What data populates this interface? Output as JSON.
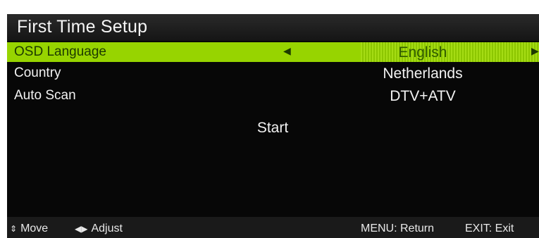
{
  "title": "First Time Setup",
  "menu": [
    {
      "label": "OSD Language",
      "value": "English",
      "selected": true
    },
    {
      "label": "Country",
      "value": "Netherlands",
      "selected": false
    },
    {
      "label": "Auto Scan",
      "value": "DTV+ATV",
      "selected": false
    }
  ],
  "start_label": "Start",
  "footer": {
    "move_icon": "up-down-arrows-icon",
    "move_label": "Move",
    "adjust_icon": "left-right-arrows-icon",
    "adjust_label": "Adjust",
    "menu_hint": "MENU: Return",
    "exit_hint": "EXIT: Exit"
  },
  "colors": {
    "highlight": "#97d400",
    "background": "#070707",
    "text": "#f2f2f2"
  }
}
